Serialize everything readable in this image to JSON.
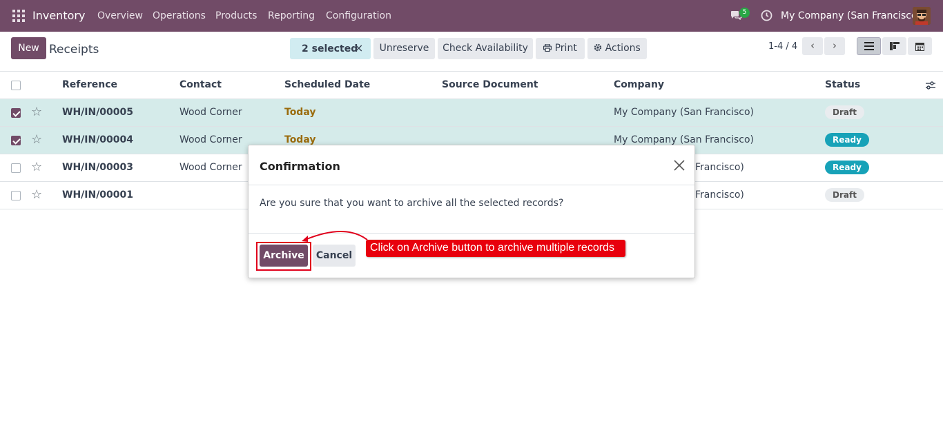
{
  "topbar": {
    "app_name": "Inventory",
    "menu": [
      "Overview",
      "Operations",
      "Products",
      "Reporting",
      "Configuration"
    ],
    "chat_badge": "5",
    "company": "My Company (San Francisco)"
  },
  "control": {
    "new_label": "New",
    "title": "Receipts",
    "selected_label": "2 selected",
    "clear_selection": "×",
    "unreserve": "Unreserve",
    "check_availability": "Check Availability",
    "print": "Print",
    "actions": "Actions",
    "pager": "1-4 / 4"
  },
  "table": {
    "headers": [
      "Reference",
      "Contact",
      "Scheduled Date",
      "Source Document",
      "Company",
      "Status"
    ],
    "rows": [
      {
        "reference": "WH/IN/00005",
        "contact": "Wood Corner",
        "date": "Today",
        "company": "My Company (San Francisco)",
        "status": "Draft",
        "checked": true
      },
      {
        "reference": "WH/IN/00004",
        "contact": "Wood Corner",
        "date": "Today",
        "company": "My Company (San Francisco)",
        "status": "Ready",
        "checked": true
      },
      {
        "reference": "WH/IN/00003",
        "contact": "Wood Corner",
        "date": "",
        "company": "Francisco)",
        "status": "Ready",
        "checked": false
      },
      {
        "reference": "WH/IN/00001",
        "contact": "",
        "date": "",
        "company": "Francisco)",
        "status": "Draft",
        "checked": false
      }
    ]
  },
  "dialog": {
    "title": "Confirmation",
    "message": "Are you sure that you want to archive all the selected records?",
    "archive_label": "Archive",
    "cancel_label": "Cancel"
  },
  "annotation": {
    "text": "Click on Archive button to archive multiple records"
  },
  "colors": {
    "brand": "#714b67",
    "selected_row": "#d5ebea",
    "ready": "#17a2b8",
    "callout": "#e8000d"
  }
}
